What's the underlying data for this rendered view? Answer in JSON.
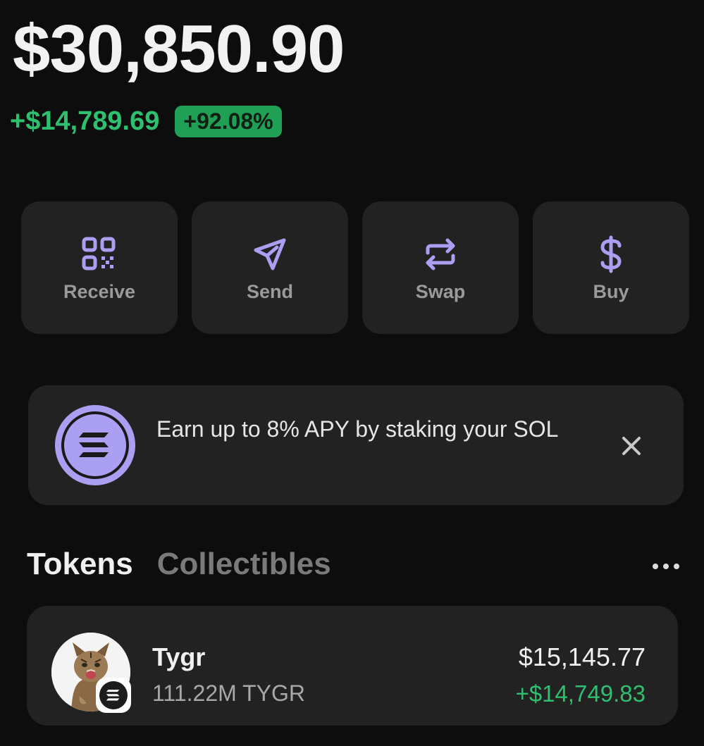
{
  "balance": {
    "total": "$30,850.90",
    "change_amount": "+$14,789.69",
    "change_percent": "+92.08%"
  },
  "actions": [
    {
      "label": "Receive",
      "icon": "qr-code-icon"
    },
    {
      "label": "Send",
      "icon": "send-icon"
    },
    {
      "label": "Swap",
      "icon": "swap-icon"
    },
    {
      "label": "Buy",
      "icon": "dollar-icon"
    }
  ],
  "banner": {
    "text": "Earn up to 8% APY by staking your SOL",
    "icon": "solana-icon",
    "close_icon": "close-icon"
  },
  "tabs": {
    "active": "Tokens",
    "inactive": "Collectibles",
    "more_icon": "more-horizontal-icon"
  },
  "tokens": [
    {
      "name": "Tygr",
      "amount": "111.22M TYGR",
      "value": "$15,145.77",
      "change": "+$14,749.83",
      "avatar": "tiger-cub-avatar",
      "chain_icon": "solana-icon"
    }
  ],
  "colors": {
    "accent": "#ab9ff2",
    "positive": "#2ec06f",
    "badge": "#1fa055",
    "card": "#222222",
    "background": "#0d0d0d"
  }
}
